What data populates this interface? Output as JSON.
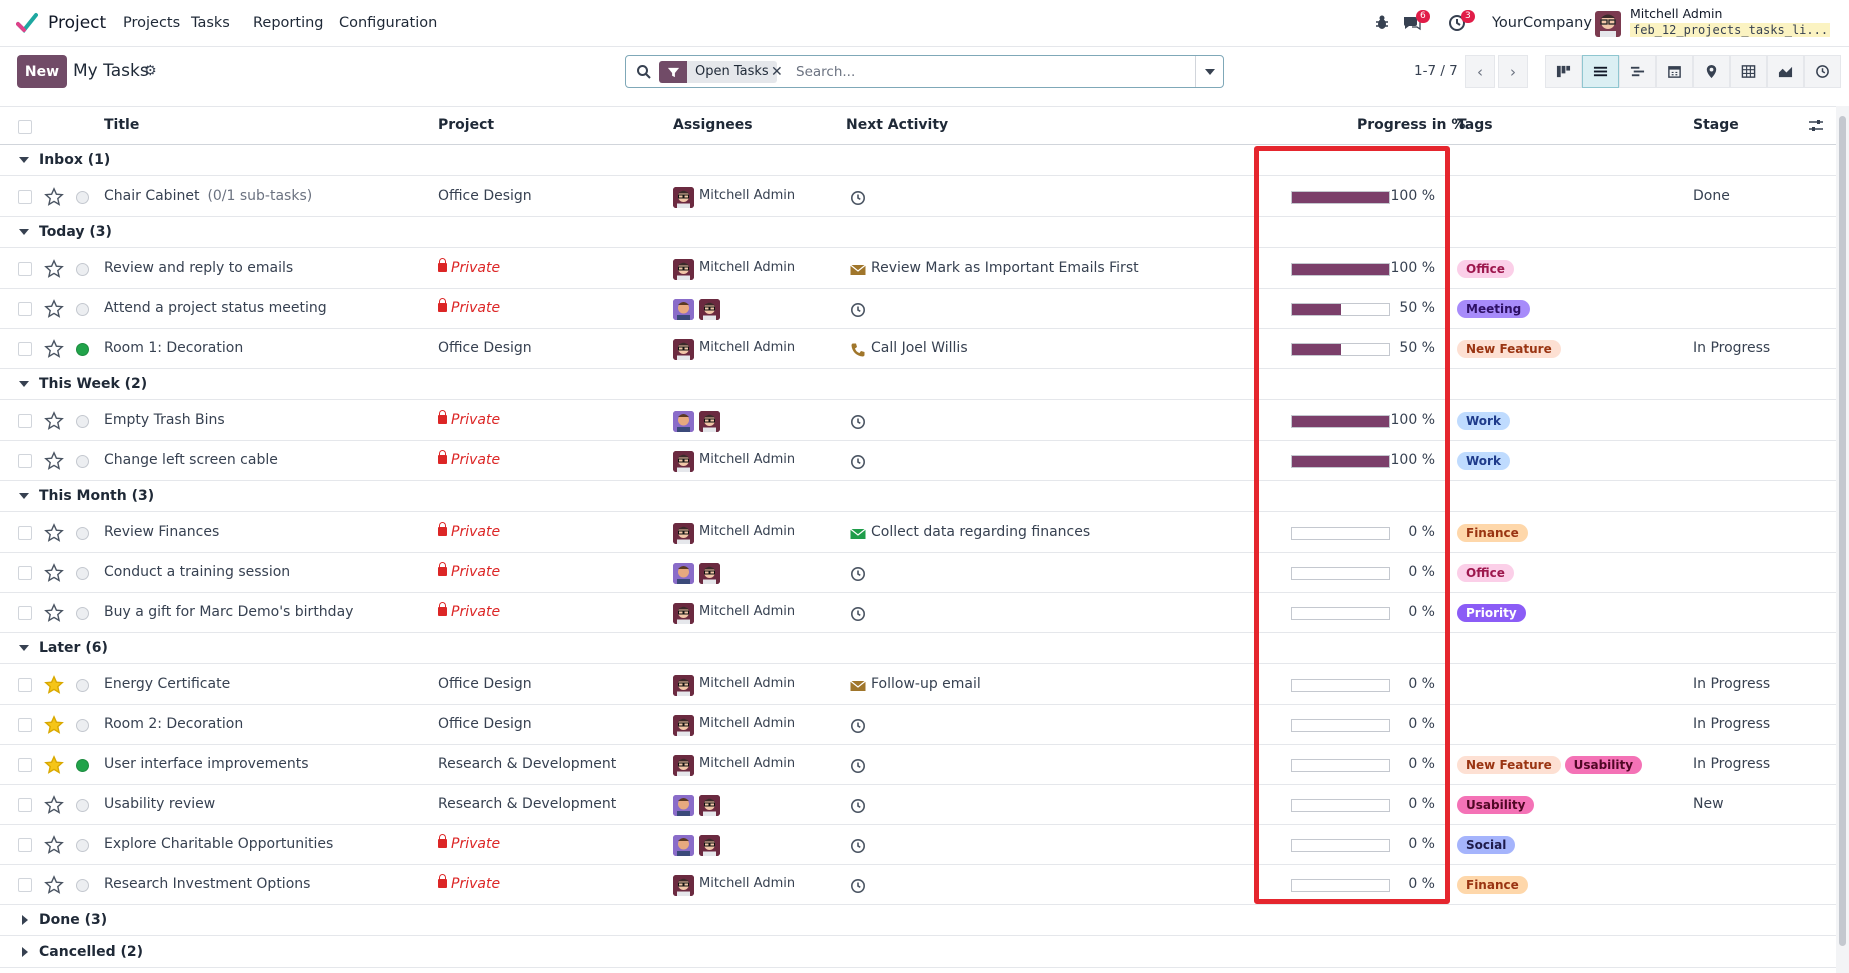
{
  "app": {
    "name": "Project",
    "menu": [
      "Projects",
      "Tasks",
      "Reporting",
      "Configuration"
    ],
    "chat_count": "6",
    "activity_count": "3",
    "company": "YourCompany",
    "user_name": "Mitchell Admin",
    "db_name": "feb_12_projects_tasks_li..."
  },
  "control": {
    "new_label": "New",
    "breadcrumb": "My Tasks",
    "facet": "Open Tasks",
    "search_placeholder": "Search...",
    "pager": "1-7 / 7"
  },
  "columns": {
    "title": "Title",
    "project": "Project",
    "assignees": "Assignees",
    "next_activity": "Next Activity",
    "progress": "Progress in %",
    "tags": "Tags",
    "stage": "Stage"
  },
  "groups": [
    {
      "label": "Inbox (1)",
      "expanded": true,
      "rows": [
        {
          "title": "Chair Cabinet",
          "subtasks": "(0/1 sub-tasks)",
          "starred": false,
          "status": "normal",
          "project": "Office Design",
          "private": false,
          "assignees": [
            "Mitchell Admin"
          ],
          "assignee_label": "Mitchell Admin",
          "activity": "",
          "activity_icon": "clock",
          "progress": 100,
          "progress_label": "100 %",
          "tags": [],
          "stage": "Done"
        }
      ]
    },
    {
      "label": "Today (3)",
      "expanded": true,
      "rows": [
        {
          "title": "Review and reply to emails",
          "subtasks": "",
          "starred": false,
          "status": "normal",
          "project": "Private",
          "private": true,
          "assignees": [
            "Mitchell Admin"
          ],
          "assignee_label": "Mitchell Admin",
          "activity": "Review Mark as Important Emails First",
          "activity_icon": "envelope-brown",
          "progress": 100,
          "progress_label": "100 %",
          "tags": [
            {
              "name": "Office",
              "bg": "#fbcfe8",
              "fg": "#9d174d"
            }
          ],
          "stage": ""
        },
        {
          "title": "Attend a project status meeting",
          "subtasks": "",
          "starred": false,
          "status": "normal",
          "project": "Private",
          "private": true,
          "assignees": [
            "Marc Demo",
            "Mitchell Admin"
          ],
          "assignee_label": "",
          "activity": "",
          "activity_icon": "clock",
          "progress": 50,
          "progress_label": "50 %",
          "tags": [
            {
              "name": "Meeting",
              "bg": "#a78bfa",
              "fg": "#2e1065"
            }
          ],
          "stage": ""
        },
        {
          "title": "Room 1: Decoration",
          "subtasks": "",
          "starred": false,
          "status": "green",
          "project": "Office Design",
          "private": false,
          "assignees": [
            "Mitchell Admin"
          ],
          "assignee_label": "Mitchell Admin",
          "activity": "Call Joel Willis",
          "activity_icon": "phone",
          "progress": 50,
          "progress_label": "50 %",
          "tags": [
            {
              "name": "New Feature",
              "bg": "#fde0d3",
              "fg": "#9a3412"
            }
          ],
          "stage": "In Progress"
        }
      ]
    },
    {
      "label": "This Week (2)",
      "expanded": true,
      "rows": [
        {
          "title": "Empty Trash Bins",
          "subtasks": "",
          "starred": false,
          "status": "normal",
          "project": "Private",
          "private": true,
          "assignees": [
            "Marc Demo",
            "Mitchell Admin"
          ],
          "assignee_label": "",
          "activity": "",
          "activity_icon": "clock",
          "progress": 100,
          "progress_label": "100 %",
          "tags": [
            {
              "name": "Work",
              "bg": "#bfdbfe",
              "fg": "#1e3a8a"
            }
          ],
          "stage": ""
        },
        {
          "title": "Change left screen cable",
          "subtasks": "",
          "starred": false,
          "status": "normal",
          "project": "Private",
          "private": true,
          "assignees": [
            "Mitchell Admin"
          ],
          "assignee_label": "Mitchell Admin",
          "activity": "",
          "activity_icon": "clock",
          "progress": 100,
          "progress_label": "100 %",
          "tags": [
            {
              "name": "Work",
              "bg": "#bfdbfe",
              "fg": "#1e3a8a"
            }
          ],
          "stage": ""
        }
      ]
    },
    {
      "label": "This Month (3)",
      "expanded": true,
      "rows": [
        {
          "title": "Review Finances",
          "subtasks": "",
          "starred": false,
          "status": "normal",
          "project": "Private",
          "private": true,
          "assignees": [
            "Mitchell Admin"
          ],
          "assignee_label": "Mitchell Admin",
          "activity": "Collect data regarding finances",
          "activity_icon": "envelope-green",
          "progress": 0,
          "progress_label": "0 %",
          "tags": [
            {
              "name": "Finance",
              "bg": "#fed7aa",
              "fg": "#9a3412"
            }
          ],
          "stage": ""
        },
        {
          "title": "Conduct a training session",
          "subtasks": "",
          "starred": false,
          "status": "normal",
          "project": "Private",
          "private": true,
          "assignees": [
            "Marc Demo",
            "Mitchell Admin"
          ],
          "assignee_label": "",
          "activity": "",
          "activity_icon": "clock",
          "progress": 0,
          "progress_label": "0 %",
          "tags": [
            {
              "name": "Office",
              "bg": "#fbcfe8",
              "fg": "#9d174d"
            }
          ],
          "stage": ""
        },
        {
          "title": "Buy a gift for Marc Demo's birthday",
          "subtasks": "",
          "starred": false,
          "status": "normal",
          "project": "Private",
          "private": true,
          "assignees": [
            "Mitchell Admin"
          ],
          "assignee_label": "Mitchell Admin",
          "activity": "",
          "activity_icon": "clock",
          "progress": 0,
          "progress_label": "0 %",
          "tags": [
            {
              "name": "Priority",
              "bg": "#8b5cf6",
              "fg": "#ffffff"
            }
          ],
          "stage": ""
        }
      ]
    },
    {
      "label": "Later (6)",
      "expanded": true,
      "rows": [
        {
          "title": "Energy Certificate",
          "subtasks": "",
          "starred": true,
          "status": "normal",
          "project": "Office Design",
          "private": false,
          "assignees": [
            "Mitchell Admin"
          ],
          "assignee_label": "Mitchell Admin",
          "activity": "Follow-up email",
          "activity_icon": "envelope-brown",
          "progress": 0,
          "progress_label": "0 %",
          "tags": [],
          "stage": "In Progress"
        },
        {
          "title": "Room 2: Decoration",
          "subtasks": "",
          "starred": true,
          "status": "normal",
          "project": "Office Design",
          "private": false,
          "assignees": [
            "Mitchell Admin"
          ],
          "assignee_label": "Mitchell Admin",
          "activity": "",
          "activity_icon": "clock",
          "progress": 0,
          "progress_label": "0 %",
          "tags": [],
          "stage": "In Progress"
        },
        {
          "title": "User interface improvements",
          "subtasks": "",
          "starred": true,
          "status": "green",
          "project": "Research & Development",
          "private": false,
          "assignees": [
            "Mitchell Admin"
          ],
          "assignee_label": "Mitchell Admin",
          "activity": "",
          "activity_icon": "clock",
          "progress": 0,
          "progress_label": "0 %",
          "tags": [
            {
              "name": "New Feature",
              "bg": "#fde0d3",
              "fg": "#9a3412"
            },
            {
              "name": "Usability",
              "bg": "#f472b6",
              "fg": "#500724"
            }
          ],
          "stage": "In Progress"
        },
        {
          "title": "Usability review",
          "subtasks": "",
          "starred": false,
          "status": "normal",
          "project": "Research & Development",
          "private": false,
          "assignees": [
            "Marc Demo",
            "Mitchell Admin"
          ],
          "assignee_label": "",
          "activity": "",
          "activity_icon": "clock",
          "progress": 0,
          "progress_label": "0 %",
          "tags": [
            {
              "name": "Usability",
              "bg": "#f472b6",
              "fg": "#500724"
            }
          ],
          "stage": "New"
        },
        {
          "title": "Explore Charitable Opportunities",
          "subtasks": "",
          "starred": false,
          "status": "normal",
          "project": "Private",
          "private": true,
          "assignees": [
            "Marc Demo",
            "Mitchell Admin"
          ],
          "assignee_label": "",
          "activity": "",
          "activity_icon": "clock",
          "progress": 0,
          "progress_label": "0 %",
          "tags": [
            {
              "name": "Social",
              "bg": "#a5b4fc",
              "fg": "#1e1b4b"
            }
          ],
          "stage": ""
        },
        {
          "title": "Research Investment Options",
          "subtasks": "",
          "starred": false,
          "status": "normal",
          "project": "Private",
          "private": true,
          "assignees": [
            "Mitchell Admin"
          ],
          "assignee_label": "Mitchell Admin",
          "activity": "",
          "activity_icon": "clock",
          "progress": 0,
          "progress_label": "0 %",
          "tags": [
            {
              "name": "Finance",
              "bg": "#fed7aa",
              "fg": "#9a3412"
            }
          ],
          "stage": ""
        }
      ]
    },
    {
      "label": "Done (3)",
      "expanded": false,
      "rows": []
    },
    {
      "label": "Cancelled (2)",
      "expanded": false,
      "rows": []
    }
  ],
  "colors": {
    "brand": "#714b67",
    "progress_fill": "#7b3f6a",
    "highlight": "#e5262e",
    "private": "#dc2626",
    "star_on": "#f5c518",
    "done_dot": "#21a34a"
  }
}
